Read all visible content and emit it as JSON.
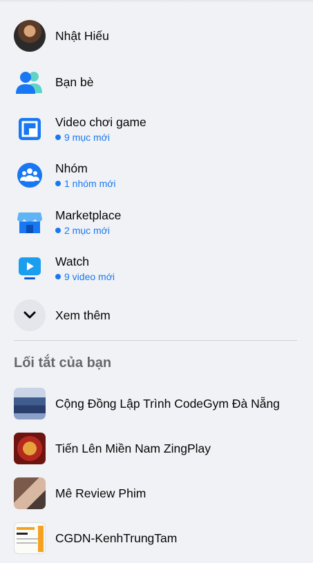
{
  "nav": {
    "items": [
      {
        "label": "Nhật Hiếu",
        "icon": "profile-avatar"
      },
      {
        "label": "Bạn bè",
        "icon": "friends-icon"
      },
      {
        "label": "Video chơi game",
        "icon": "gaming-video-icon",
        "sub": "9 mục mới"
      },
      {
        "label": "Nhóm",
        "icon": "groups-icon",
        "sub": "1 nhóm mới"
      },
      {
        "label": "Marketplace",
        "icon": "marketplace-icon",
        "sub": "2 mục mới"
      },
      {
        "label": "Watch",
        "icon": "watch-icon",
        "sub": "9 video mới"
      },
      {
        "label": "Xem thêm",
        "icon": "chevron-down-icon"
      }
    ]
  },
  "shortcuts": {
    "title": "Lối tắt của bạn",
    "items": [
      {
        "label": "Cộng Đồng Lập Trình CodeGym Đà Nẵng"
      },
      {
        "label": "Tiến Lên Miền Nam ZingPlay"
      },
      {
        "label": "Mê Review Phim"
      },
      {
        "label": "CGDN-KenhTrungTam"
      }
    ]
  },
  "colors": {
    "accent": "#1877f2",
    "background": "#f0f2f5",
    "text": "#050505",
    "secondary": "#65676b"
  }
}
